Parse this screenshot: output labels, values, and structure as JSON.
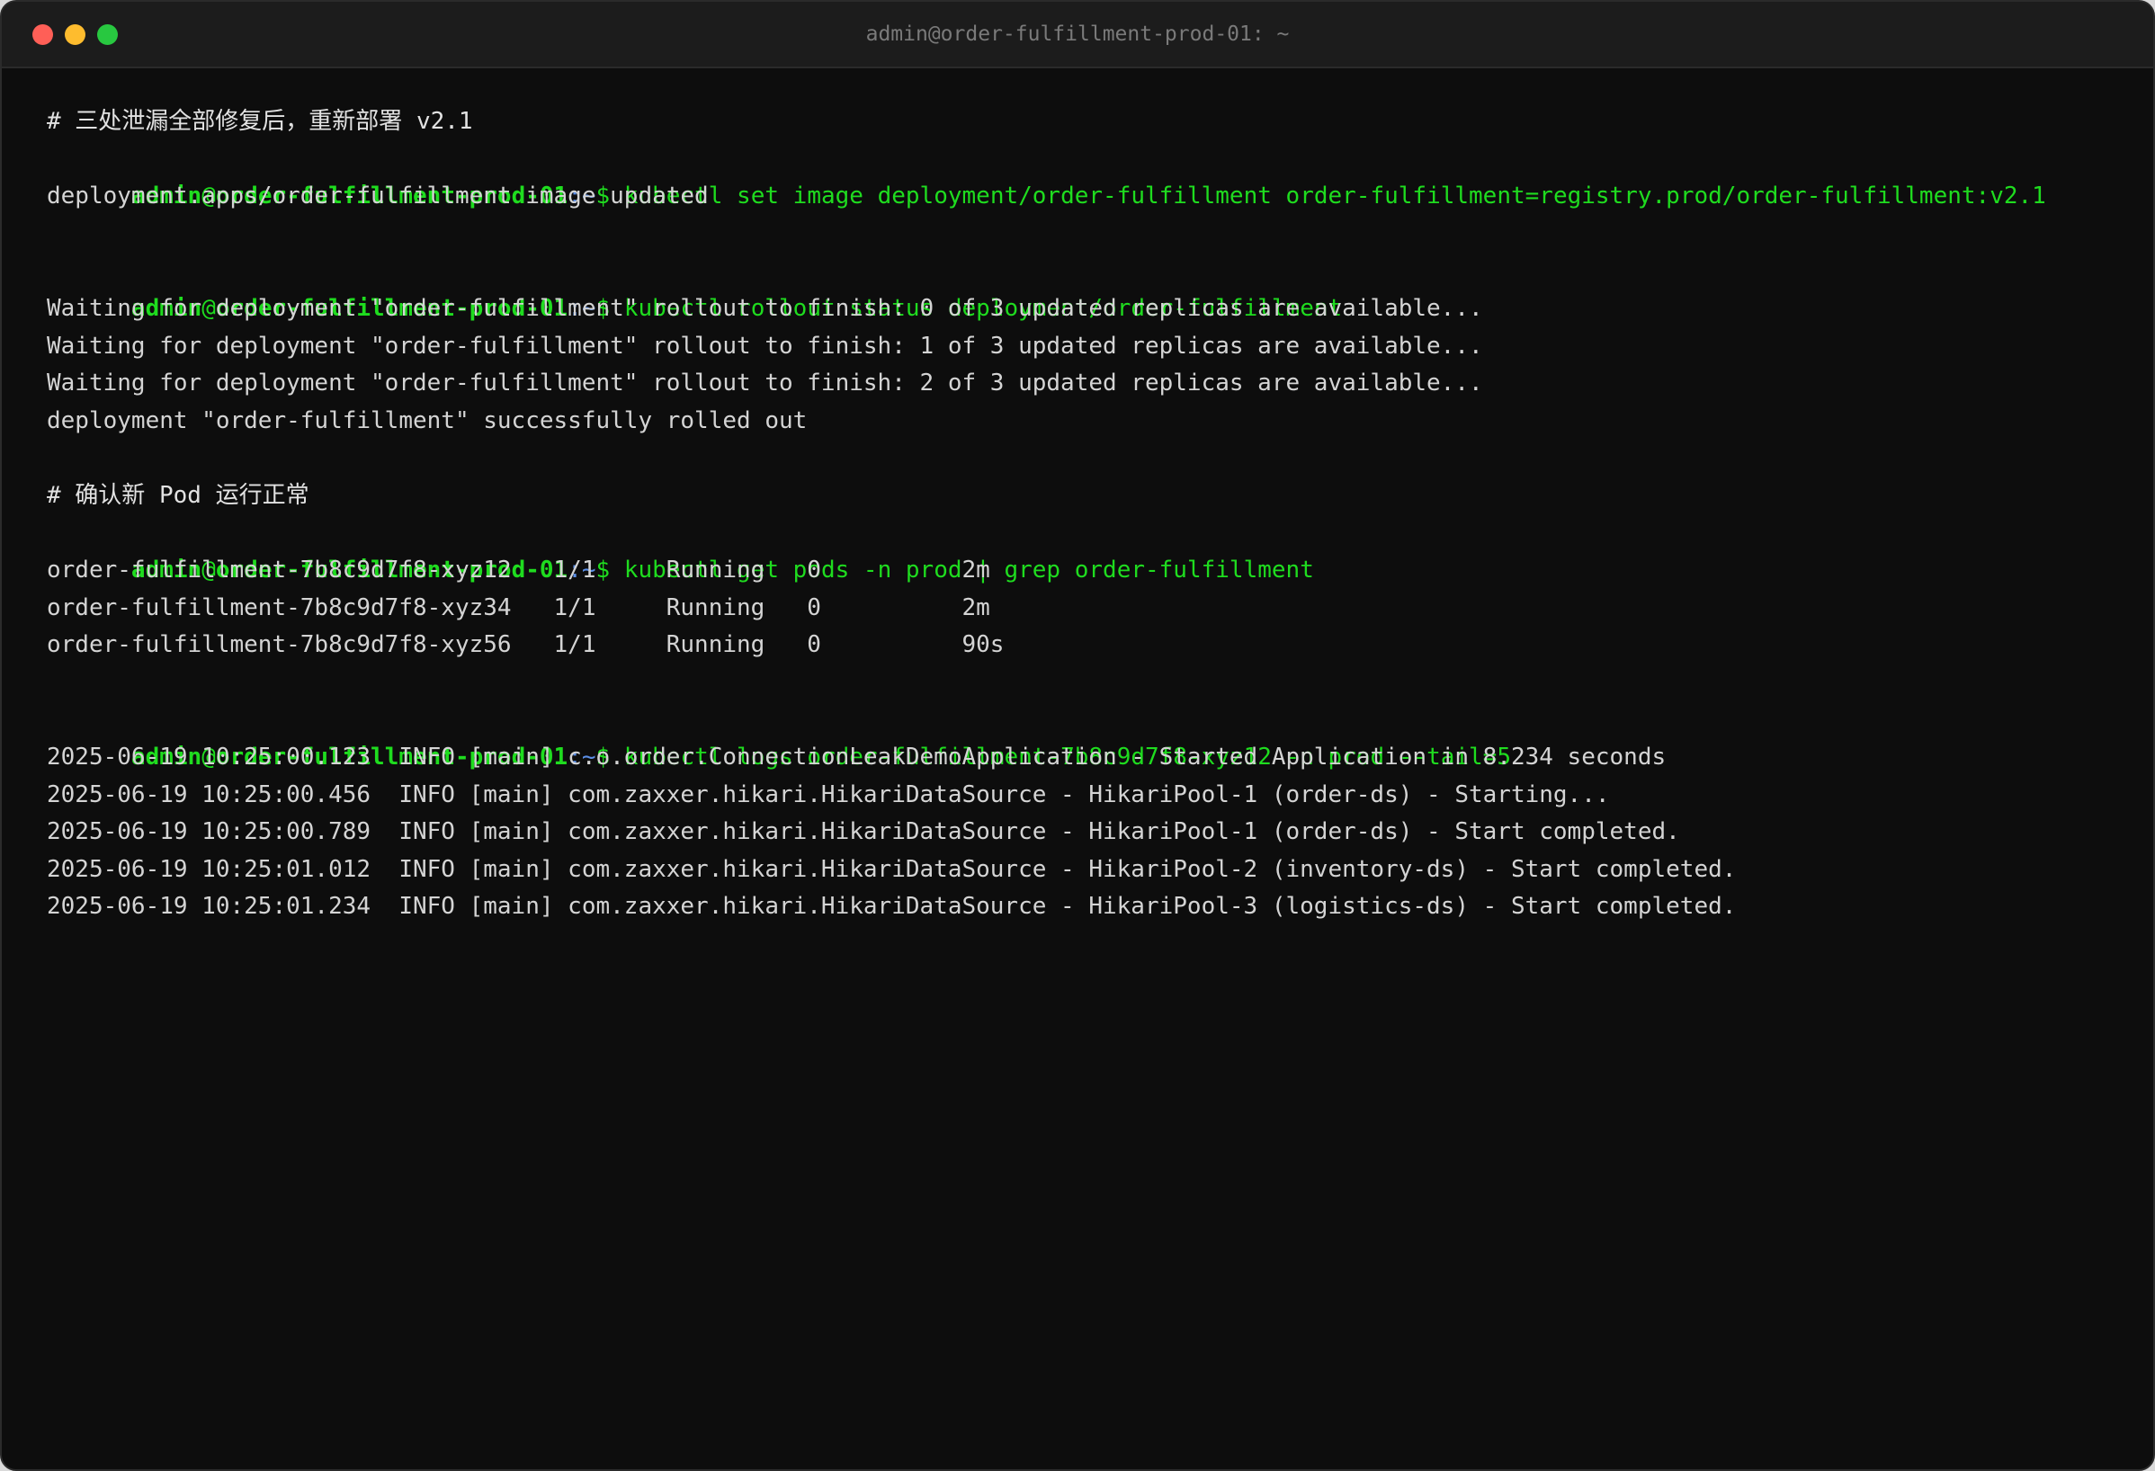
{
  "window": {
    "title": "admin@order-fulfillment-prod-01: ~",
    "lights": {
      "close_color": "#ff5f57",
      "minimize_color": "#febc2e",
      "maximize_color": "#28c840"
    }
  },
  "prompt": {
    "user": "admin",
    "at": "@",
    "host": "order-fulfillment-prod-01",
    "path": ":~",
    "dollar": "$"
  },
  "colors": {
    "background": "#0d0d0d",
    "prompt_green": "#1fdc1f",
    "path_blue": "#5c8fe6",
    "output_text": "#d4d4d4"
  },
  "blocks": [
    {
      "comment": "# 三处泄漏全部修复后，重新部署 v2.1",
      "command": "kubectl set image deployment/order-fulfillment order-fulfillment=registry.prod/order-fulfillment:v2.1",
      "output": [
        "deployment.apps/order-fulfillment image updated"
      ]
    },
    {
      "command": "kubectl rollout status deployment/order-fulfillment",
      "output": [
        "Waiting for deployment \"order-fulfillment\" rollout to finish: 0 of 3 updated replicas are available...",
        "Waiting for deployment \"order-fulfillment\" rollout to finish: 1 of 3 updated replicas are available...",
        "Waiting for deployment \"order-fulfillment\" rollout to finish: 2 of 3 updated replicas are available...",
        "deployment \"order-fulfillment\" successfully rolled out"
      ]
    },
    {
      "comment": "# 确认新 Pod 运行正常",
      "command": "kubectl get pods -n prod | grep order-fulfillment",
      "pods": [
        {
          "name": "order-fulfillment-7b8c9d7f8-xyz12",
          "ready": "1/1",
          "status": "Running",
          "restarts": "0",
          "age": "2m"
        },
        {
          "name": "order-fulfillment-7b8c9d7f8-xyz34",
          "ready": "1/1",
          "status": "Running",
          "restarts": "0",
          "age": "2m"
        },
        {
          "name": "order-fulfillment-7b8c9d7f8-xyz56",
          "ready": "1/1",
          "status": "Running",
          "restarts": "0",
          "age": "90s"
        }
      ]
    },
    {
      "command": "kubectl logs order-fulfillment-7b8c9d7f8-xyz12 -n prod --tail=5",
      "output": [
        "2025-06-19 10:25:00.123  INFO [main] c.o.order.ConnectionLeakDemoApplication - Started Application in 8.234 seconds",
        "2025-06-19 10:25:00.456  INFO [main] com.zaxxer.hikari.HikariDataSource - HikariPool-1 (order-ds) - Starting...",
        "2025-06-19 10:25:00.789  INFO [main] com.zaxxer.hikari.HikariDataSource - HikariPool-1 (order-ds) - Start completed.",
        "2025-06-19 10:25:01.012  INFO [main] com.zaxxer.hikari.HikariDataSource - HikariPool-2 (inventory-ds) - Start completed.",
        "2025-06-19 10:25:01.234  INFO [main] com.zaxxer.hikari.HikariDataSource - HikariPool-3 (logistics-ds) - Start completed."
      ]
    }
  ]
}
